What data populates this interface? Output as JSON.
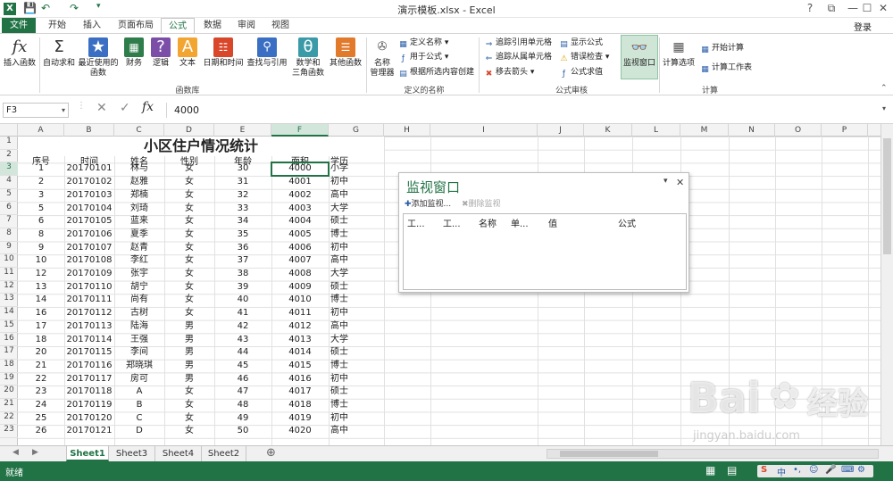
{
  "window": {
    "title": "演示模板.xlsx - Excel",
    "login": "登录",
    "controls": [
      "?",
      "⧉",
      "—",
      "☐",
      "✕"
    ]
  },
  "colors": {
    "accent": "#217346",
    "header_bg": "#f3f3f3",
    "watch_title": "#217346"
  },
  "tabs": [
    {
      "label": "文件",
      "id": "file"
    },
    {
      "label": "开始",
      "id": "home"
    },
    {
      "label": "插入",
      "id": "insert"
    },
    {
      "label": "页面布局",
      "id": "layout"
    },
    {
      "label": "公式",
      "id": "formulas",
      "active": true
    },
    {
      "label": "数据",
      "id": "data"
    },
    {
      "label": "审阅",
      "id": "review"
    },
    {
      "label": "视图",
      "id": "view"
    }
  ],
  "ribbon": {
    "insert_function": "插入函数",
    "autosum": "自动求和",
    "recent": "最近使用的",
    "recent2": "函数",
    "finance": "财务",
    "logic": "逻辑",
    "text": "文本",
    "datetime": "日期和时间",
    "lookup": "查找与引用",
    "math": "数学和",
    "math2": "三角函数",
    "other": "其他函数",
    "name_manager": "名称",
    "name_manager2": "管理器",
    "define_name": "定义名称",
    "use_in_formula": "用于公式",
    "create_from_sel": "根据所选内容创建",
    "trace_prec": "追踪引用单元格",
    "trace_dep": "追踪从属单元格",
    "remove_arrows": "移去箭头",
    "show_formulas": "显示公式",
    "error_check": "错误检查",
    "evaluate": "公式求值",
    "watch_window": "监视窗口",
    "calc_options": "计算选项",
    "calc_now": "开始计算",
    "calc_sheet": "计算工作表",
    "group_lib": "函数库",
    "group_names": "定义的名称",
    "group_audit": "公式审核",
    "group_calc": "计算"
  },
  "formula_bar": {
    "name_box": "F3",
    "value": "4000",
    "fx": "fx"
  },
  "columns": [
    "A",
    "B",
    "C",
    "D",
    "E",
    "F",
    "G",
    "H",
    "I",
    "J",
    "K",
    "L",
    "M",
    "N",
    "O",
    "P"
  ],
  "selected_column": "F",
  "selected_row": 3,
  "rows": [
    "1",
    "2",
    "3",
    "4",
    "5",
    "6",
    "7",
    "8",
    "9",
    "10",
    "11",
    "12",
    "13",
    "14",
    "15",
    "16",
    "17",
    "18",
    "19",
    "20",
    "21",
    "22",
    "23"
  ],
  "sheet": {
    "title": "小区住户情况统计",
    "headers": [
      "序号",
      "时间",
      "姓名",
      "性别",
      "年龄",
      "面积",
      "学历"
    ],
    "data": [
      [
        "1",
        "20170101",
        "林与",
        "女",
        "30",
        "4000",
        "小学"
      ],
      [
        "2",
        "20170102",
        "赵雅",
        "女",
        "31",
        "4001",
        "初中"
      ],
      [
        "3",
        "20170103",
        "郑楠",
        "女",
        "32",
        "4002",
        "高中"
      ],
      [
        "5",
        "20170104",
        "刘琦",
        "女",
        "33",
        "4003",
        "大学"
      ],
      [
        "6",
        "20170105",
        "蓝来",
        "女",
        "34",
        "4004",
        "硕士"
      ],
      [
        "8",
        "20170106",
        "夏季",
        "女",
        "35",
        "4005",
        "博士"
      ],
      [
        "9",
        "20170107",
        "赵青",
        "女",
        "36",
        "4006",
        "初中"
      ],
      [
        "10",
        "20170108",
        "李红",
        "女",
        "37",
        "4007",
        "高中"
      ],
      [
        "12",
        "20170109",
        "张宇",
        "女",
        "38",
        "4008",
        "大学"
      ],
      [
        "13",
        "20170110",
        "胡宁",
        "女",
        "39",
        "4009",
        "硕士"
      ],
      [
        "14",
        "20170111",
        "尚有",
        "女",
        "40",
        "4010",
        "博士"
      ],
      [
        "16",
        "20170112",
        "古树",
        "女",
        "41",
        "4011",
        "初中"
      ],
      [
        "17",
        "20170113",
        "陆海",
        "男",
        "42",
        "4012",
        "高中"
      ],
      [
        "18",
        "20170114",
        "王强",
        "男",
        "43",
        "4013",
        "大学"
      ],
      [
        "20",
        "20170115",
        "李间",
        "男",
        "44",
        "4014",
        "硕士"
      ],
      [
        "21",
        "20170116",
        "郑晓琪",
        "男",
        "45",
        "4015",
        "博士"
      ],
      [
        "22",
        "20170117",
        "房可",
        "男",
        "46",
        "4016",
        "初中"
      ],
      [
        "23",
        "20170118",
        "A",
        "女",
        "47",
        "4017",
        "硕士"
      ],
      [
        "24",
        "20170119",
        "B",
        "女",
        "48",
        "4018",
        "博士"
      ],
      [
        "25",
        "20170120",
        "C",
        "女",
        "49",
        "4019",
        "初中"
      ],
      [
        "26",
        "20170121",
        "D",
        "女",
        "50",
        "4020",
        "高中"
      ]
    ]
  },
  "watch": {
    "title": "监视窗口",
    "add": "添加监视...",
    "remove": "删除监视",
    "columns": [
      "工...",
      "工...",
      "名称",
      "单...",
      "值",
      "公式"
    ]
  },
  "sheet_tabs": [
    "Sheet1",
    "Sheet3",
    "Sheet4",
    "Sheet2"
  ],
  "active_sheet": "Sheet1",
  "status": "就绪",
  "watermark": {
    "text": "Bai",
    "text2": "经验",
    "url": "jingyan.baidu.com"
  }
}
